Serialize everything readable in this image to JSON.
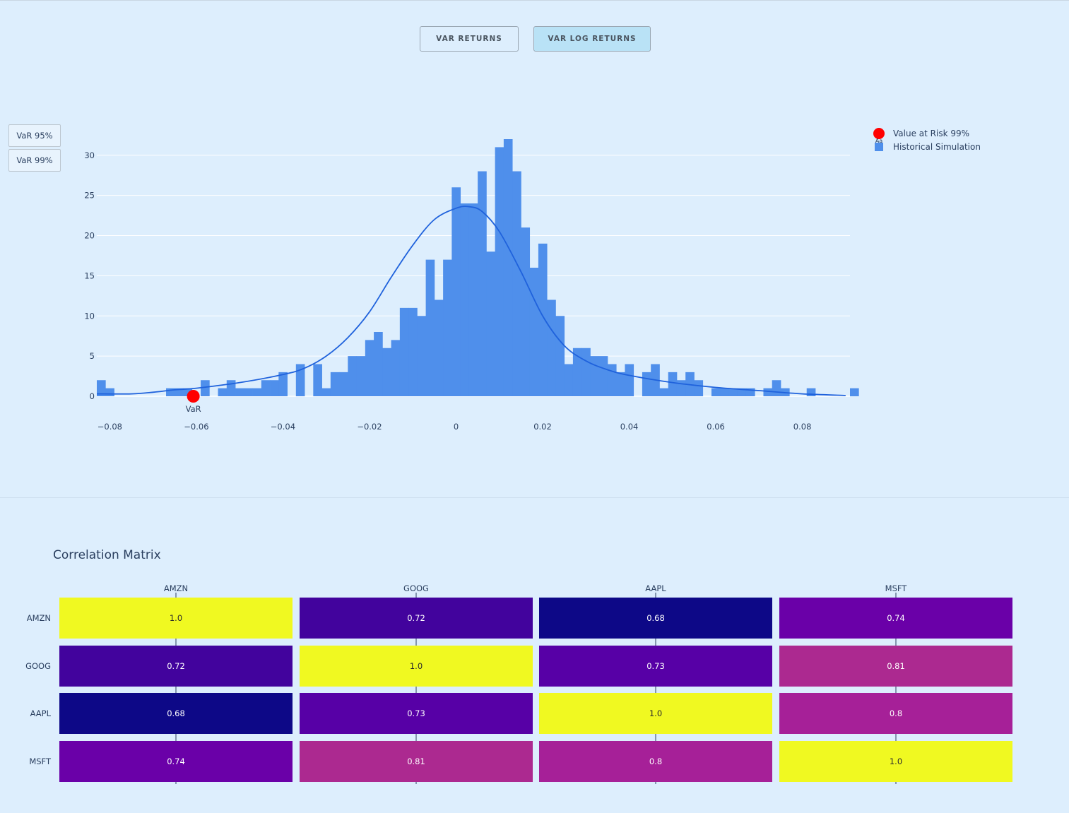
{
  "buttons": {
    "var_returns": "VAR RETURNS",
    "var_log_returns": "VAR LOG RETURNS"
  },
  "var_selector": {
    "var95": "VaR 95%",
    "var99": "VaR 99%"
  },
  "colors": {
    "background": "#ddeefd",
    "bar": "#4f8feb",
    "kde": "#1f62dc",
    "var_marker": "#ff0000",
    "active_button": "#b9e2f6"
  },
  "chart_data": [
    {
      "type": "bar",
      "title": "",
      "xlabel": "",
      "ylabel": "",
      "xlim": [
        -0.083,
        0.091
      ],
      "ylim": [
        0,
        32
      ],
      "grid": true,
      "legend_position": "top-right",
      "x_ticks": [
        "−0.08",
        "−0.06",
        "−0.04",
        "−0.02",
        "0",
        "0.02",
        "0.04",
        "0.06",
        "0.08"
      ],
      "y_ticks": [
        "0",
        "5",
        "10",
        "15",
        "20",
        "25",
        "30"
      ],
      "series": [
        {
          "name": "Historical Simulation",
          "bin_start": -0.083,
          "bin_width": 0.002,
          "values": [
            2,
            1,
            0,
            0,
            0,
            0,
            0,
            0,
            1,
            1,
            1,
            0,
            2,
            0,
            1,
            2,
            1,
            1,
            1,
            2,
            2,
            3,
            0,
            4,
            0,
            4,
            1,
            3,
            3,
            5,
            5,
            7,
            8,
            6,
            7,
            11,
            11,
            10,
            17,
            12,
            17,
            26,
            24,
            24,
            28,
            18,
            31,
            32,
            28,
            21,
            16,
            19,
            12,
            10,
            4,
            6,
            6,
            5,
            5,
            4,
            3,
            4,
            0,
            3,
            4,
            1,
            3,
            2,
            3,
            2,
            0,
            1,
            1,
            1,
            1,
            1,
            0,
            1,
            2,
            1,
            0,
            0,
            1,
            0,
            0,
            0,
            0,
            1
          ]
        },
        {
          "name": "KDE",
          "x": [
            -0.083,
            -0.075,
            -0.07,
            -0.065,
            -0.06,
            -0.05,
            -0.04,
            -0.035,
            -0.03,
            -0.025,
            -0.02,
            -0.015,
            -0.01,
            -0.005,
            0,
            0.003,
            0.006,
            0.01,
            0.015,
            0.02,
            0.025,
            0.03,
            0.035,
            0.04,
            0.05,
            0.06,
            0.07,
            0.08,
            0.09
          ],
          "y": [
            0.3,
            0.3,
            0.5,
            0.8,
            1.0,
            1.7,
            2.7,
            3.5,
            5.0,
            7.3,
            10.5,
            14.8,
            18.8,
            22.0,
            23.4,
            23.6,
            23.0,
            20.5,
            15.5,
            10.0,
            6.3,
            4.4,
            3.3,
            2.6,
            1.7,
            1.1,
            0.7,
            0.3,
            0.1
          ]
        },
        {
          "name": "Value at Risk 99%",
          "x": [
            -0.0607
          ],
          "y": [
            0
          ],
          "label": "VaR"
        }
      ],
      "legend": [
        {
          "name": "Value at Risk 99%",
          "symbol": "Aa"
        },
        {
          "name": "Historical Simulation"
        }
      ]
    },
    {
      "type": "heatmap",
      "title": "Correlation Matrix",
      "x_labels": [
        "AMZN",
        "GOOG",
        "AAPL",
        "MSFT"
      ],
      "y_labels": [
        "AMZN",
        "GOOG",
        "AAPL",
        "MSFT"
      ],
      "values": [
        [
          "1.0",
          "0.72",
          "0.68",
          "0.74"
        ],
        [
          "0.72",
          "1.0",
          "0.73",
          "0.81"
        ],
        [
          "0.68",
          "0.73",
          "1.0",
          "0.8"
        ],
        [
          "0.74",
          "0.81",
          "0.8",
          "1.0"
        ]
      ]
    }
  ]
}
